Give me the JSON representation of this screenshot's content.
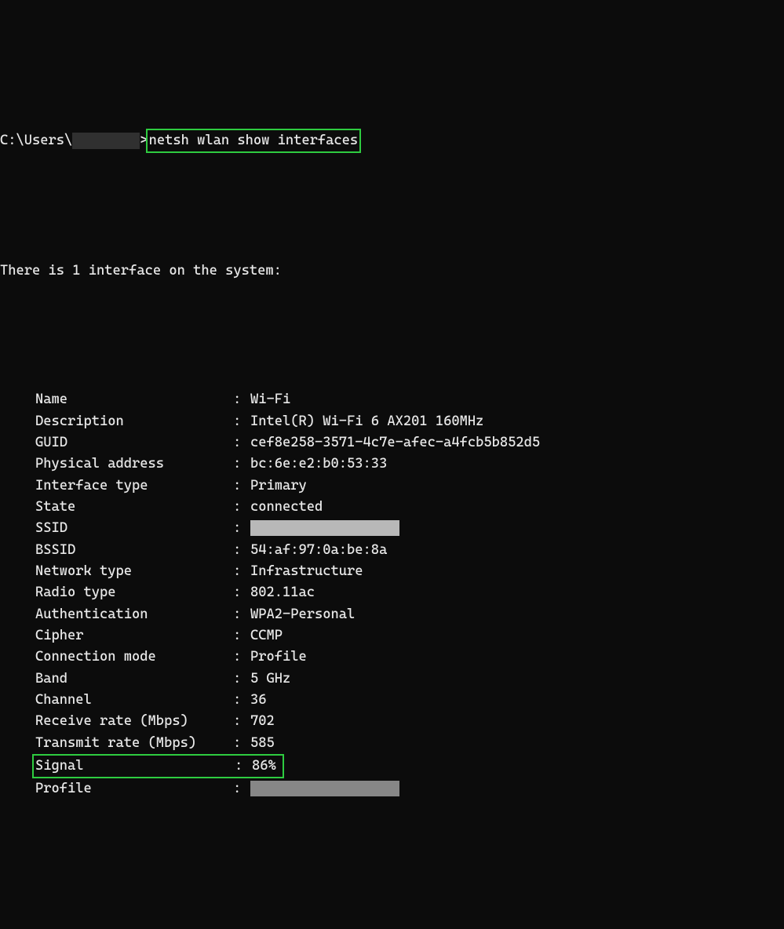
{
  "prompt": {
    "path": "C:\\Users\\",
    "redacted_user_width": 86,
    "prompt_char": ">",
    "command": "netsh wlan show interfaces"
  },
  "summary": "There is 1 interface on the system:",
  "rows": [
    {
      "label": "Name",
      "value": "Wi-Fi"
    },
    {
      "label": "Description",
      "value": "Intel(R) Wi-Fi 6 AX201 160MHz"
    },
    {
      "label": "GUID",
      "value": "cef8e258-3571-4c7e-afec-a4fcb5b852d5"
    },
    {
      "label": "Physical address",
      "value": "bc:6e:e2:b0:53:33"
    },
    {
      "label": "Interface type",
      "value": "Primary"
    },
    {
      "label": "State",
      "value": "connected"
    },
    {
      "label": "SSID",
      "value": "",
      "redacted": true,
      "redact_width": 190,
      "redact_light": true
    },
    {
      "label": "BSSID",
      "value": "54:af:97:0a:be:8a"
    },
    {
      "label": "Network type",
      "value": "Infrastructure"
    },
    {
      "label": "Radio type",
      "value": "802.11ac"
    },
    {
      "label": "Authentication",
      "value": "WPA2-Personal"
    },
    {
      "label": "Cipher",
      "value": "CCMP"
    },
    {
      "label": "Connection mode",
      "value": "Profile"
    },
    {
      "label": "Band",
      "value": "5 GHz"
    },
    {
      "label": "Channel",
      "value": "36"
    },
    {
      "label": "Receive rate (Mbps)",
      "value": "702"
    },
    {
      "label": "Transmit rate (Mbps)",
      "value": "585"
    },
    {
      "label": "Signal",
      "value": "86%",
      "highlight": true
    },
    {
      "label": "Profile",
      "value": "",
      "redacted": true,
      "redact_width": 190,
      "redact_mid": true
    }
  ]
}
